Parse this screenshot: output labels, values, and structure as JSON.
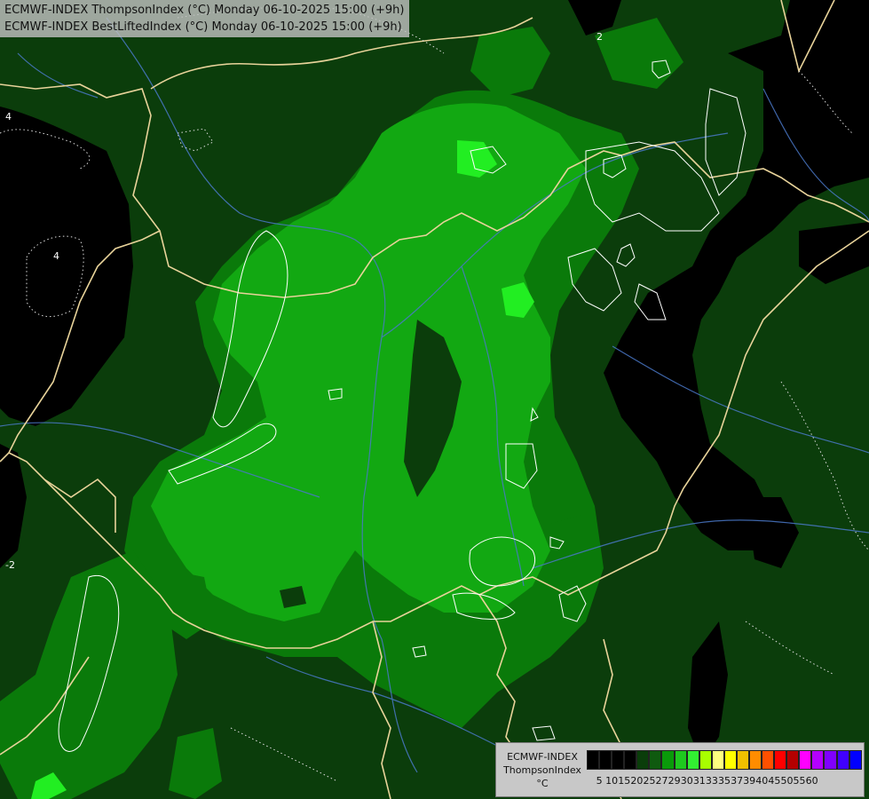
{
  "header": {
    "line1": "ECMWF-INDEX ThompsonIndex (°C) Monday 06-10-2025 15:00 (+9h)",
    "line2": "ECMWF-INDEX BestLiftedIndex (°C) Monday 06-10-2025 15:00 (+9h)"
  },
  "legend": {
    "title": "ECMWF-INDEX",
    "variable": "ThompsonIndex",
    "unit": "°C",
    "colors": [
      "#000000",
      "#000000",
      "#000000",
      "#000000",
      "#0a3d0a",
      "#0f5a0f",
      "#0a9a0a",
      "#1ec81e",
      "#32f032",
      "#a8ff00",
      "#ffff80",
      "#ffff00",
      "#f0c000",
      "#ff8c00",
      "#ff5000",
      "#ff0000",
      "#b40000",
      "#ff00ff",
      "#b400ff",
      "#8000ff",
      "#4000ff",
      "#0000ff"
    ],
    "ticks": [
      "5",
      "10",
      "15",
      "20",
      "25",
      "27",
      "29",
      "30",
      "31",
      "33",
      "35",
      "37",
      "39",
      "40",
      "45",
      "50",
      "55",
      "60"
    ]
  },
  "map": {
    "colors": {
      "dark_green": "#0b3d0b",
      "mid_green": "#0a7a0a",
      "light_green": "#12a812",
      "bright_green": "#22dd22",
      "black": "#000000",
      "border": "#e8d39a",
      "river": "#4a78c8",
      "contour": "#ffffff"
    },
    "contour_labels": [
      "4",
      "-2",
      "2"
    ]
  }
}
